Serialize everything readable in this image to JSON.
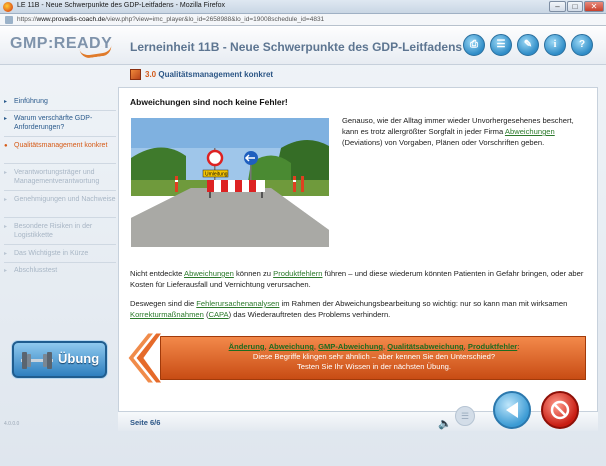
{
  "browser": {
    "window_title": "LE 11B - Neue Schwerpunkte des GDP-Leitfadens - Mozilla Firefox",
    "url_prefix": "https://",
    "url_host": "www.provadis-coach.de",
    "url_path": "/view.php?view=imc_player&lo_id=2658988&lo_id=19008schedule_id=4831",
    "minimize": "–",
    "maximize": "□",
    "close": "✕"
  },
  "header": {
    "logo": "GMP:READY",
    "lesson_title": "Lerneinheit 11B - Neue Schwerpunkte des GDP-Leitfadens",
    "buttons": [
      "print-icon",
      "list-icon",
      "notes-icon",
      "info-icon",
      "help-icon"
    ],
    "button_glyphs": [
      "⎙",
      "☰",
      "✎",
      "i",
      "?"
    ]
  },
  "section": {
    "number": "3.0",
    "title": "Qualitätsmanagement konkret"
  },
  "sidebar": {
    "items": [
      {
        "label": "Einführung",
        "state": "normal"
      },
      {
        "label": "Warum verschärfte GDP-Anforderungen?",
        "state": "normal"
      },
      {
        "label": "Qualitätsmanagement konkret",
        "state": "active"
      },
      {
        "label": "Verantwortungsträger und Managementverantwortung",
        "state": "disabled"
      },
      {
        "label": "Genehmigungen und Nachweise",
        "state": "disabled"
      },
      {
        "label": "Besondere Risiken in der Logistikkette",
        "state": "disabled"
      },
      {
        "label": "Das Wichtigste in Kürze",
        "state": "disabled"
      },
      {
        "label": "Abschlusstest",
        "state": "disabled"
      }
    ],
    "exercise_label": "Übung"
  },
  "content": {
    "heading": "Abweichungen sind noch keine Fehler!",
    "sign_text": "Umleitung",
    "intro_a": "Genauso, wie der Alltag immer wieder Unvorhergesehenes beschert, kann es trotz allergrößter Sorgfalt in jeder Firma ",
    "intro_link": "Abweichungen",
    "intro_b": " (Deviations) von Vorgaben, Plänen oder Vorschriften geben.",
    "p2_a": "Nicht entdeckte ",
    "p2_link1": "Abweichungen",
    "p2_b": " können zu ",
    "p2_link2": "Produktfehlern",
    "p2_c": " führen – und diese wiederum könnten Patienten in Gefahr bringen, oder aber Kosten für Lieferausfall und Vernichtung verursachen.",
    "p3_a": "Deswegen sind die ",
    "p3_link1": "Fehlerursachenanalysen",
    "p3_b": " im Rahmen der Abweichungsbearbeitung so wichtig: nur so kann man mit wirksamen ",
    "p3_link2": "Korrekturmaßnahmen",
    "p3_c": " (",
    "p3_link3": "CAPA",
    "p3_d": ") das Wiederauftreten des Problems verhindern."
  },
  "banner": {
    "terms": [
      "Änderung",
      "Abweichung",
      "GMP-Abweichung",
      "Qualitätsabweichung",
      "Produktfehler"
    ],
    "terms_end": ":",
    "line2": "Diese Begriffe klingen sehr ähnlich – aber kennen Sie den Unterschied?",
    "line3": "Testen Sie Ihr Wissen in der nächsten Übung."
  },
  "footer": {
    "page": "Seite 6/6",
    "build": "4.0.0.0"
  },
  "colors": {
    "accent_orange": "#d65a16",
    "nav_blue": "#2a5a8c",
    "link_green": "#2b7a2b",
    "title_blue": "#5d7591"
  }
}
